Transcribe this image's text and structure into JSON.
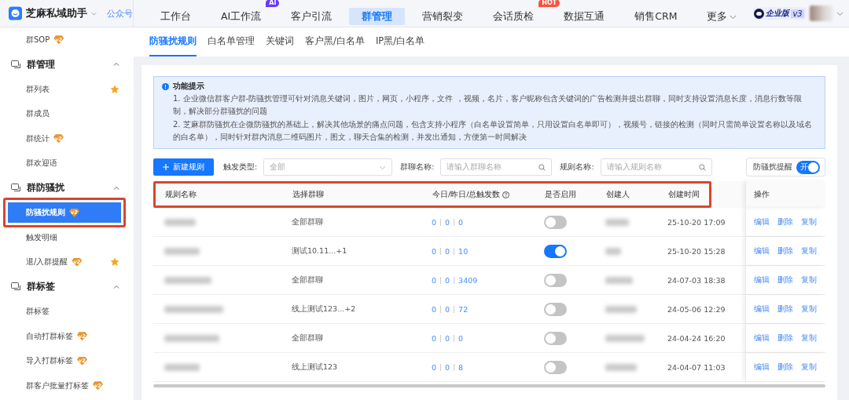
{
  "app": {
    "name": "芝麻私域助手",
    "account_link": "公众号"
  },
  "top_nav": [
    {
      "label": "工作台",
      "selected": false
    },
    {
      "label": "AI工作流",
      "selected": false,
      "badge": {
        "text": "AI",
        "color": "#6a3bf5"
      }
    },
    {
      "label": "客户引流",
      "selected": false
    },
    {
      "label": "群管理",
      "selected": true
    },
    {
      "label": "营销裂变",
      "selected": false
    },
    {
      "label": "会话质检",
      "selected": false,
      "badge": {
        "text": "HOT",
        "color": "#f4553f"
      }
    },
    {
      "label": "数据互通",
      "selected": false
    },
    {
      "label": "销售CRM",
      "selected": false
    },
    {
      "label": "更多",
      "selected": false,
      "dropdown": true
    }
  ],
  "edition": {
    "label": "企业版",
    "version": "v3"
  },
  "sidebar": [
    {
      "kind": "item",
      "label": "群SOP",
      "badge": "v2",
      "starred": false,
      "selected": false,
      "highlighted": false
    },
    {
      "kind": "section",
      "label": "群管理",
      "expanded": true
    },
    {
      "kind": "item",
      "label": "群列表",
      "starred": true,
      "selected": false,
      "highlighted": false
    },
    {
      "kind": "item",
      "label": "群成员",
      "starred": false,
      "selected": false,
      "highlighted": false
    },
    {
      "kind": "item",
      "label": "群统计",
      "badge": "v2",
      "starred": false,
      "selected": false,
      "highlighted": false
    },
    {
      "kind": "item",
      "label": "群欢迎语",
      "starred": false,
      "selected": false,
      "highlighted": false
    },
    {
      "kind": "section",
      "label": "群防骚扰",
      "expanded": true
    },
    {
      "kind": "item",
      "label": "防骚扰规则",
      "badge": "v2",
      "starred": false,
      "selected": true,
      "highlighted": true
    },
    {
      "kind": "item",
      "label": "触发明细",
      "starred": false,
      "selected": false,
      "highlighted": false
    },
    {
      "kind": "item",
      "label": "退/入群提醒",
      "badge": "v2",
      "starred": true,
      "selected": false,
      "highlighted": false
    },
    {
      "kind": "section",
      "label": "群标签",
      "expanded": true
    },
    {
      "kind": "item",
      "label": "群标签",
      "starred": false,
      "selected": false,
      "highlighted": false
    },
    {
      "kind": "item",
      "label": "自动打群标签",
      "badge": "v2",
      "starred": false,
      "selected": false,
      "highlighted": false
    },
    {
      "kind": "item",
      "label": "导入打群标签",
      "badge": "v2",
      "starred": false,
      "selected": false,
      "highlighted": false
    },
    {
      "kind": "item",
      "label": "群客户批量打标签",
      "badge": "v2",
      "starred": false,
      "selected": false,
      "highlighted": false
    }
  ],
  "sub_tabs": [
    {
      "label": "防骚扰规则",
      "selected": true
    },
    {
      "label": "白名单管理",
      "selected": false
    },
    {
      "label": "关键词",
      "selected": false
    },
    {
      "label": "客户黑/白名单",
      "selected": false
    },
    {
      "label": "IP黑/白名单",
      "selected": false
    }
  ],
  "notice": {
    "title": "功能提示",
    "items": [
      "1. 企业微信群客户群-防骚扰管理可针对消息关键词，图片，网页，小程序，文件 ，视频，名片，客户昵称包含关键词的广告检测并提出群聊，同时支持设置消息长度，消息行数等限制，解决部分群骚扰的问题",
      "2. 芝麻群防骚扰在企微防骚扰的基础上，解决其他场景的痛点问题，包含支持小程序（白名单设置简单，只用设置白名单即可），视频号，链接的检测（同时只需简单设置名称以及域名的白名单），同时针对群内消息二维码图片，图文，聊天合集的检测，并发出通知，方便第一时间解决"
    ]
  },
  "toolbar": {
    "new_button": "新建规则",
    "filters": [
      {
        "label": "触发类型:",
        "kind": "select",
        "placeholder": "全部"
      },
      {
        "label": "群聊名称:",
        "kind": "search",
        "placeholder": "请输入群聊名称"
      },
      {
        "label": "规则名称:",
        "kind": "search",
        "placeholder": "请输入规则名称"
      }
    ],
    "reminder": {
      "label": "防骚扰提醒",
      "switch_text": "开",
      "on": true
    }
  },
  "table": {
    "header_highlighted": true,
    "columns": [
      "规则名称",
      "选择群聊",
      "今日/昨日/总触发数",
      "是否启用",
      "创建人",
      "创建时间",
      "操作"
    ],
    "rows": [
      {
        "group": "全部群聊",
        "counts": [
          "0",
          "0",
          "0"
        ],
        "enabled": false,
        "created": "25-10-20 17:09",
        "actions": [
          "编辑",
          "删除",
          "复制"
        ]
      },
      {
        "group": "测试10.11...+1",
        "counts": [
          "0",
          "0",
          "10"
        ],
        "enabled": true,
        "created": "25-10-20 15:28",
        "actions": [
          "编辑",
          "删除",
          "复制"
        ]
      },
      {
        "group": "全部群聊",
        "counts": [
          "0",
          "0",
          "3409"
        ],
        "enabled": false,
        "created": "24-07-03 18:38",
        "actions": [
          "编辑",
          "删除",
          "复制"
        ]
      },
      {
        "group": "线上测试123...+2",
        "counts": [
          "0",
          "0",
          "72"
        ],
        "enabled": false,
        "created": "24-05-06 12:29",
        "actions": [
          "编辑",
          "删除",
          "复制"
        ]
      },
      {
        "group": "全部群聊",
        "counts": [
          "0",
          "0",
          "0"
        ],
        "enabled": false,
        "created": "24-04-24 16:20",
        "actions": [
          "编辑",
          "删除",
          "复制"
        ]
      },
      {
        "group": "线上测试123",
        "counts": [
          "0",
          "0",
          "8"
        ],
        "enabled": false,
        "created": "24-04-07 11:03",
        "actions": [
          "编辑",
          "删除",
          "复制"
        ]
      }
    ]
  }
}
